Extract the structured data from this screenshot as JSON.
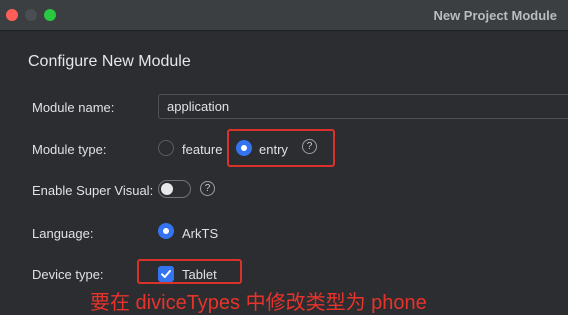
{
  "window": {
    "title": "New Project Module",
    "close_icon": "close-icon",
    "minimize_icon": "minimize-icon",
    "maximize_icon": "maximize-icon"
  },
  "form": {
    "header": "Configure New Module",
    "module_name": {
      "label": "Module name:",
      "value": "application"
    },
    "module_type": {
      "label": "Module type:",
      "options": [
        {
          "label": "feature",
          "selected": false
        },
        {
          "label": "entry",
          "selected": true
        }
      ],
      "help_icon": "help-icon",
      "help_glyph": "?"
    },
    "enable_super_visual": {
      "label": "Enable Super Visual:",
      "on": false,
      "help_icon": "help-icon",
      "help_glyph": "?"
    },
    "language": {
      "label": "Language:",
      "options": [
        {
          "label": "ArkTS",
          "selected": true
        }
      ]
    },
    "device_type": {
      "label": "Device type:",
      "options": [
        {
          "label": "Tablet",
          "checked": true
        }
      ]
    }
  },
  "annotation": {
    "text": "要在 diviceTypes 中修改类型为 phone",
    "color": "#e8332b"
  },
  "colors": {
    "accent": "#3574f0",
    "highlight_border": "#d8322a",
    "background": "#2b2d30",
    "titlebar": "#3c3f41"
  }
}
